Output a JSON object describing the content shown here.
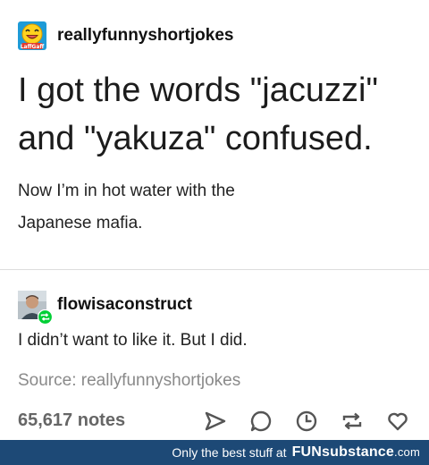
{
  "post": {
    "author": {
      "username": "reallyfunnyshortjokes",
      "avatar_icon": "laughing-emoji-icon",
      "avatar_badge": "LaffGaff"
    },
    "headline_line1": "I got the words \"jacuzzi\"",
    "headline_line2": "and \"yakuza\" confused.",
    "body_line1": "Now I’m in hot water with the",
    "body_line2": "Japanese mafia."
  },
  "reblog": {
    "username": "flowisaconstruct",
    "avatar_icon": "user-photo-avatar",
    "badge_icon": "reblog-badge-icon",
    "text": "I didn’t want to like it. But I did."
  },
  "source": {
    "label": "Source: reallyfunnyshortjokes"
  },
  "footer": {
    "notes": "65,617 notes",
    "actions": [
      "share-icon",
      "reply-icon",
      "clock-icon",
      "reblog-icon",
      "heart-icon"
    ]
  },
  "banner": {
    "tagline": "Only the best stuff at",
    "brand_main": "FUNsubstance",
    "brand_tld": ".com",
    "color": "#1d4976"
  }
}
